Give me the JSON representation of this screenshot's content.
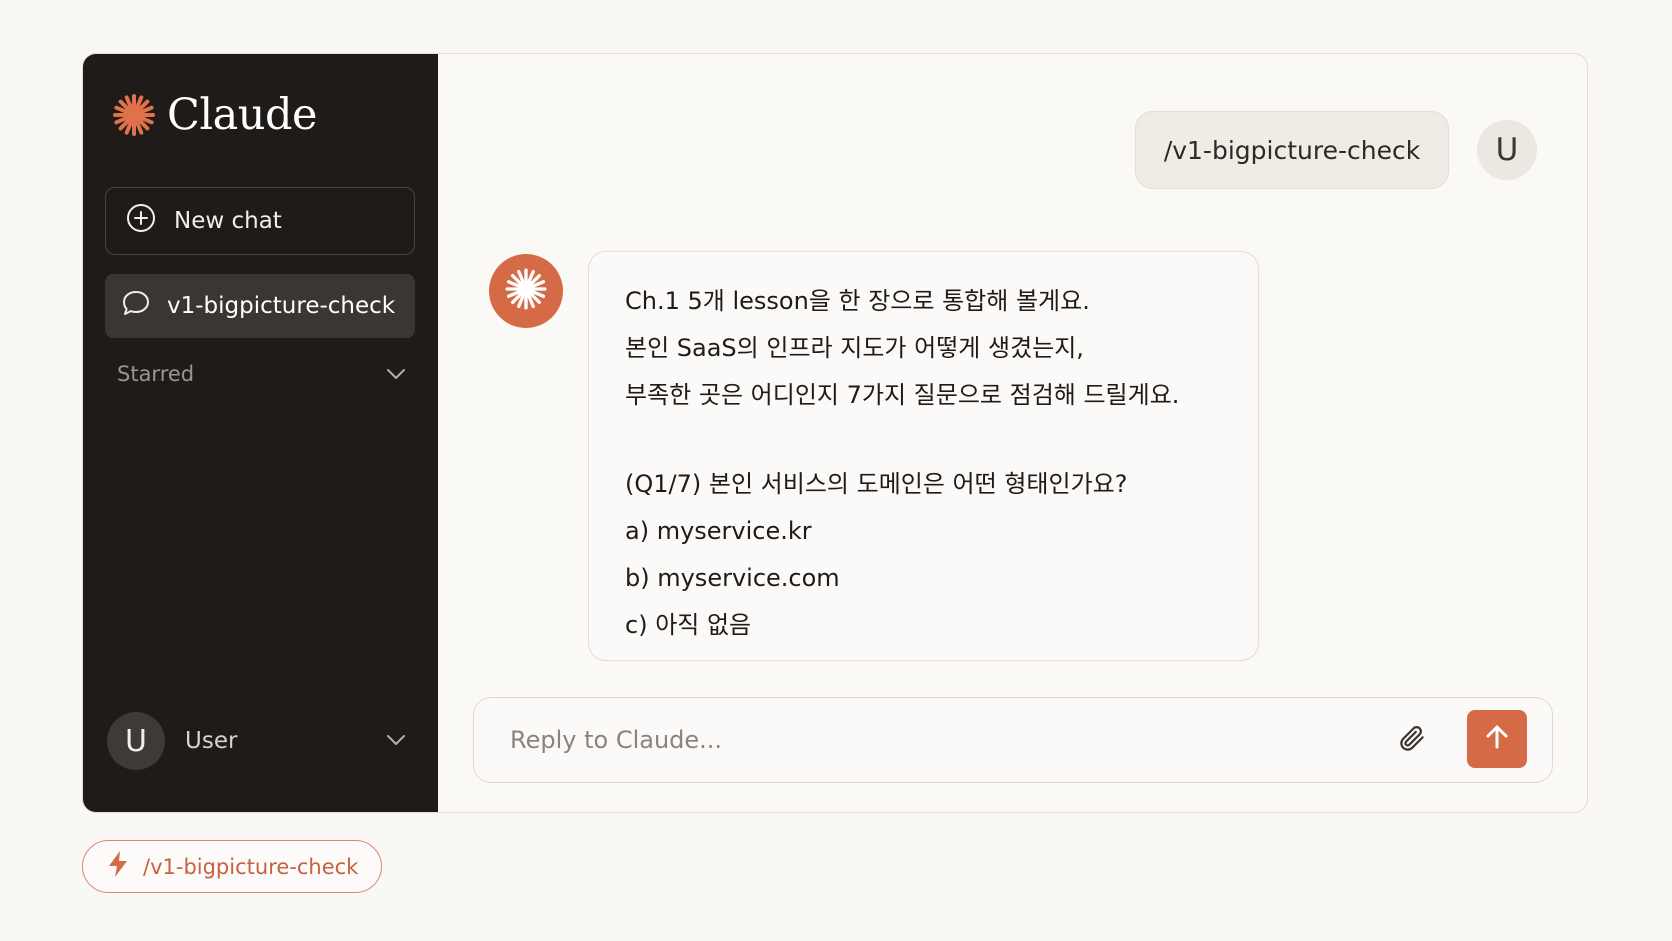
{
  "colors": {
    "accent": "#d46a46",
    "sidebar_bg": "#1f1b18",
    "page_bg": "#faf8f5"
  },
  "brand": {
    "name": "Claude",
    "icon": "claude-sparkle-icon"
  },
  "sidebar": {
    "new_chat_label": "New chat",
    "new_chat_icon": "plus-circle-icon",
    "chats": [
      {
        "label": "v1-bigpicture-check",
        "icon": "chat-bubble-icon",
        "active": true
      }
    ],
    "starred_label": "Starred",
    "user": {
      "avatar_initial": "U",
      "name": "User"
    }
  },
  "conversation": {
    "user_message": "/v1-bigpicture-check",
    "user_avatar_initial": "U",
    "assistant_message": {
      "paragraph1": [
        "Ch.1 5개 lesson을 한 장으로 통합해 볼게요.",
        "본인 SaaS의 인프라 지도가 어떻게 생겼는지,",
        "부족한 곳은 어디인지 7가지 질문으로 점검해 드릴게요."
      ],
      "question": "(Q1/7) 본인 서비스의 도메인은 어떤 형태인가요?",
      "options": [
        "a) myservice.kr",
        "b) myservice.com",
        "c) 아직 없음"
      ]
    }
  },
  "composer": {
    "placeholder": "Reply to Claude...",
    "value": "",
    "attach_icon": "paperclip-icon",
    "send_icon": "arrow-up-icon"
  },
  "command_chip": {
    "label": "/v1-bigpicture-check",
    "icon": "lightning-icon"
  }
}
